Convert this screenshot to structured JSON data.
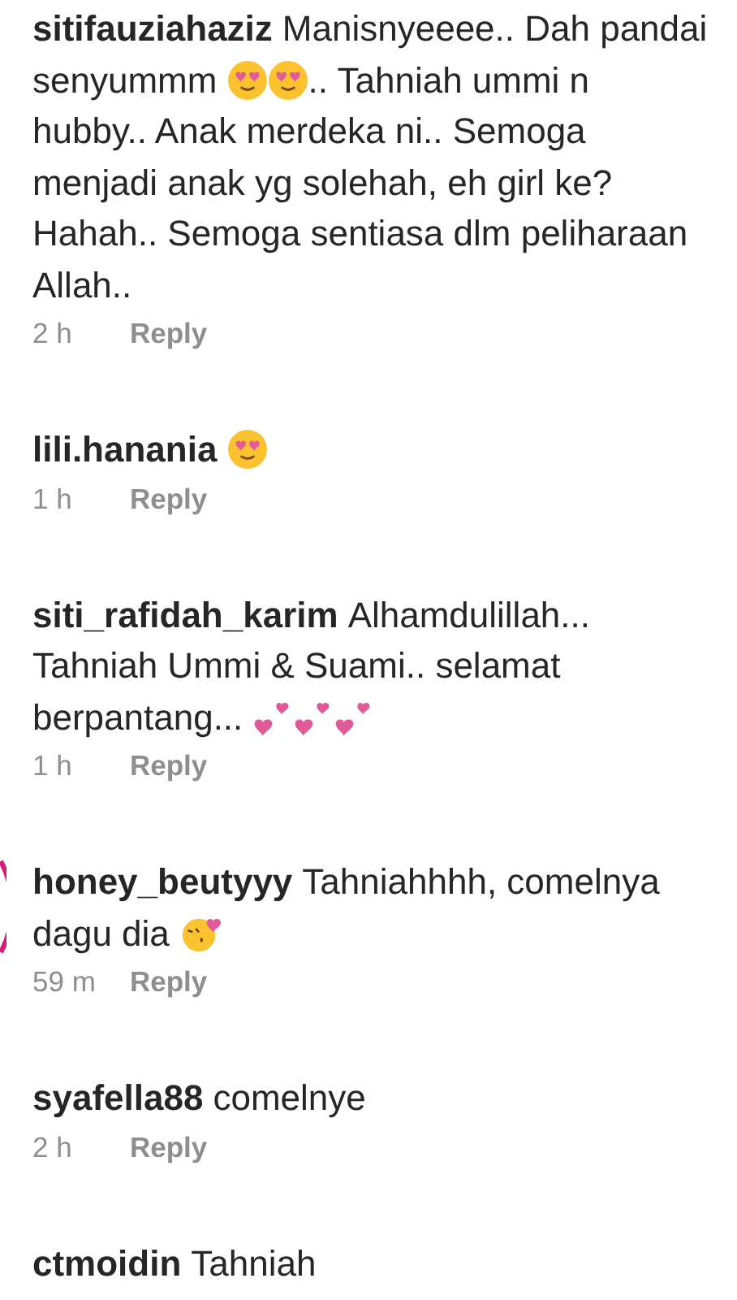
{
  "comments": [
    {
      "username": "sitifauziahaziz",
      "body": [
        {
          "kind": "text",
          "text": "Manisnyeeee.. Dah pandai senyummm"
        },
        {
          "kind": "heart-eyes"
        },
        {
          "kind": "heart-eyes"
        },
        {
          "kind": "text",
          "text": ".. Tahniah ummi n hubby.. Anak merdeka ni.. Semoga menjadi anak yg solehah, eh girl ke? Hahah.. Semoga sentiasa dlm peliharaan Allah.."
        }
      ],
      "time": "2 h",
      "reply": "Reply"
    },
    {
      "username": "lili.hanania",
      "body": [
        {
          "kind": "heart-eyes"
        }
      ],
      "time": "1 h",
      "reply": "Reply"
    },
    {
      "username": "siti_rafidah_karim",
      "body": [
        {
          "kind": "text",
          "text": "Alhamdulillah... Tahniah Ummi & Suami.. selamat berpantang..."
        },
        {
          "kind": "hearts"
        },
        {
          "kind": "hearts"
        },
        {
          "kind": "hearts"
        }
      ],
      "time": "1 h",
      "reply": "Reply"
    },
    {
      "username": "honey_beutyyy",
      "story_ring": true,
      "body": [
        {
          "kind": "text",
          "text": "Tahniahhhh, comelnya dagu dia"
        },
        {
          "kind": "kiss"
        }
      ],
      "time": "59 m",
      "reply": "Reply"
    },
    {
      "username": "syafella88",
      "body": [
        {
          "kind": "text",
          "text": "comelnye"
        }
      ],
      "time": "2 h",
      "reply": "Reply"
    },
    {
      "username": "ctmoidin",
      "body": [
        {
          "kind": "text",
          "text": "Tahniah"
        }
      ]
    }
  ]
}
